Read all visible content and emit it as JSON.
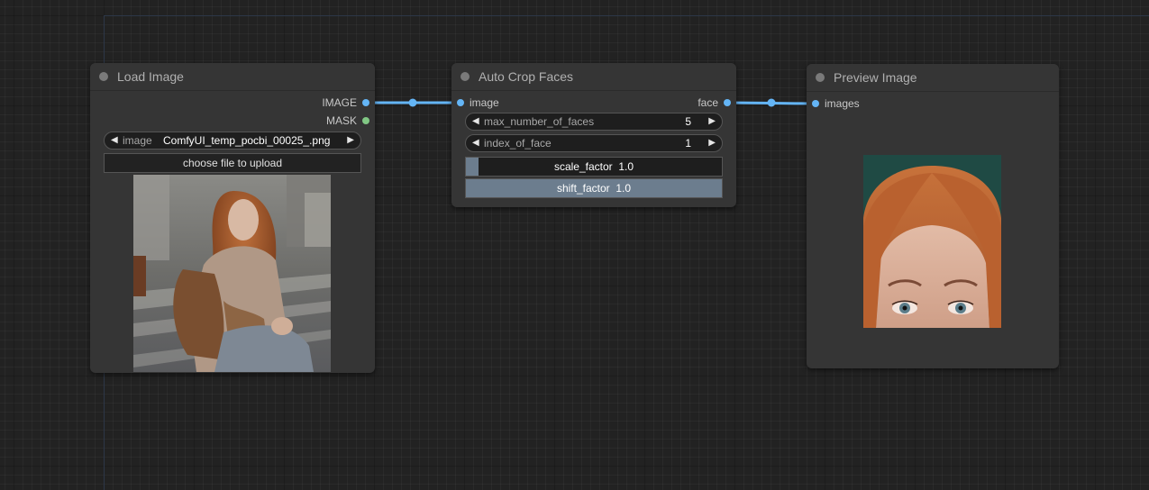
{
  "nodes": {
    "load_image": {
      "title": "Load Image",
      "outputs": [
        "IMAGE",
        "MASK"
      ],
      "image_widget": {
        "label": "image",
        "value": "ComfyUI_temp_pocbi_00025_.png"
      },
      "upload_label": "choose file to upload"
    },
    "auto_crop": {
      "title": "Auto Crop Faces",
      "input": "image",
      "output": "face",
      "max_faces": {
        "label": "max_number_of_faces",
        "value": "5"
      },
      "index_face": {
        "label": "index_of_face",
        "value": "1"
      },
      "scale_factor": {
        "label": "scale_factor",
        "value": "1.0",
        "fill": 0.05
      },
      "shift_factor": {
        "label": "shift_factor",
        "value": "1.0",
        "fill": 1.0
      }
    },
    "preview": {
      "title": "Preview Image",
      "input": "images"
    }
  },
  "colors": {
    "link": "#64b5f6",
    "pin_image": "#64b5f6",
    "pin_mask": "#81c784",
    "node_bg": "#353535",
    "canvas_bg": "#222222"
  }
}
